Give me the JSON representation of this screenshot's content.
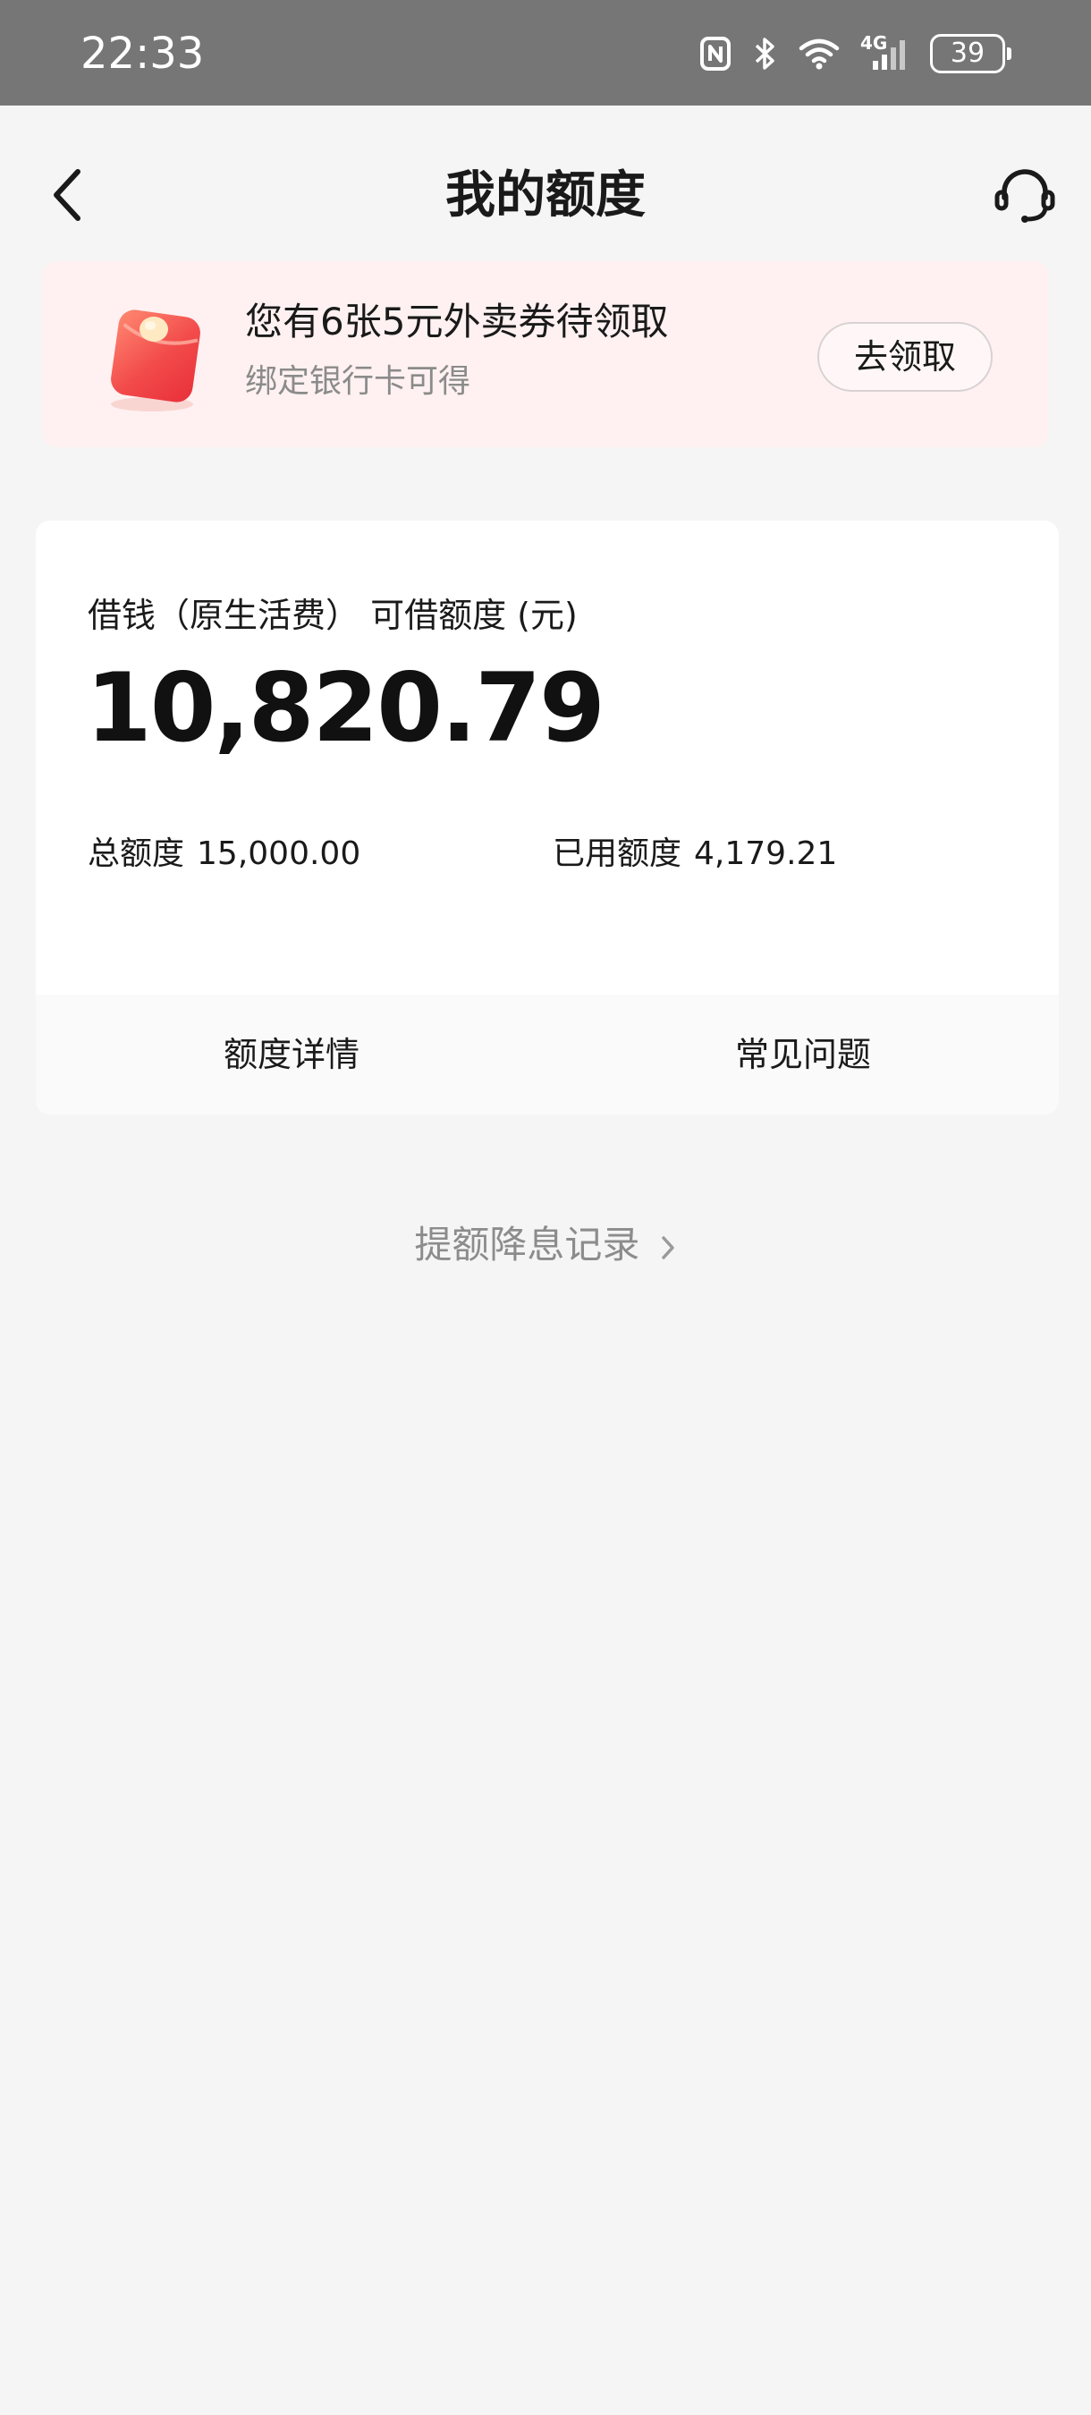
{
  "status_bar": {
    "time": "22:33",
    "battery_level": "39",
    "network_label": "4G",
    "icons": [
      "nfc-icon",
      "bluetooth-icon",
      "wifi-icon",
      "signal-4g-icon",
      "battery-icon"
    ]
  },
  "nav": {
    "title": "我的额度",
    "back_icon": "back-chevron-icon",
    "service_icon": "headset-icon"
  },
  "promo": {
    "title": "您有6张5元外卖券待领取",
    "subtitle": "绑定银行卡可得",
    "button_label": "去领取",
    "icon": "red-envelope-icon"
  },
  "quota": {
    "label": "借钱（原生活费） 可借额度 (元)",
    "available_amount": "10,820.79",
    "total_label": "总额度",
    "total_value": "15,000.00",
    "used_label": "已用额度",
    "used_value": "4,179.21",
    "actions": {
      "detail": "额度详情",
      "faq": "常见问题"
    }
  },
  "history_link": {
    "label": "提额降息记录",
    "icon": "chevron-right-icon"
  },
  "colors": {
    "status_bar_bg": "#767676",
    "page_bg": "#f5f5f5",
    "promo_bg": "#fff1f1",
    "envelope_red": "#f24a4a",
    "muted_text": "#8c8c8c"
  }
}
